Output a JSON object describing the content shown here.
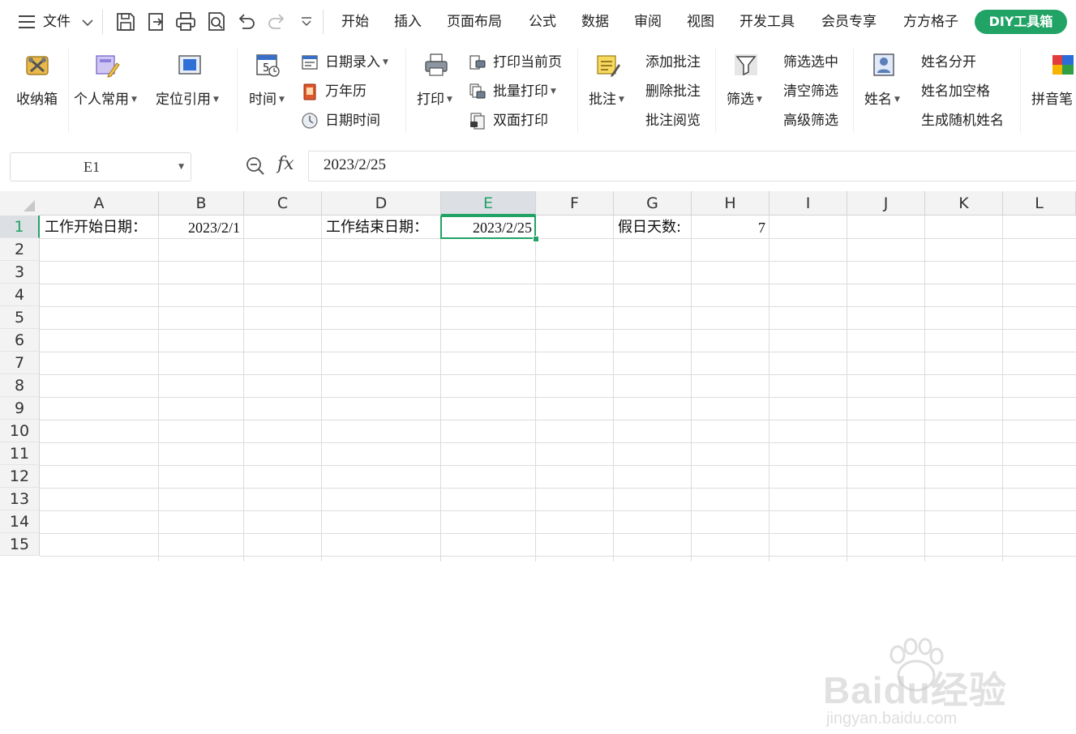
{
  "menubar": {
    "file_label": "文件",
    "tabs": [
      "开始",
      "插入",
      "页面布局",
      "公式",
      "数据",
      "审阅",
      "视图",
      "开发工具",
      "会员专享",
      "方方格子",
      "DIY工具箱"
    ],
    "active_tab": "DIY工具箱",
    "accent_color": "#21a366"
  },
  "ribbon": {
    "storage_box": "收纳箱",
    "personal_common": "个人常用",
    "locate_ref": "定位引用",
    "time": "时间",
    "date_entry": "日期录入",
    "perpetual_calendar": "万年历",
    "date_time": "日期时间",
    "print": "打印",
    "print_current_page": "打印当前页",
    "batch_print": "批量打印",
    "duplex_print": "双面打印",
    "comment": "批注",
    "add_comment": "添加批注",
    "delete_comment": "删除批注",
    "view_comments": "批注阅览",
    "filter": "筛选",
    "filter_selection": "筛选选中",
    "clear_filter": "清空筛选",
    "advanced_filter": "高级筛选",
    "name": "姓名",
    "split_name": "姓名分开",
    "name_add_space": "姓名加空格",
    "random_name": "生成随机姓名",
    "pinyin": "拼音笔"
  },
  "formula_bar": {
    "name_box": "E1",
    "fx_label": "fx",
    "formula": "2023/2/25"
  },
  "sheet": {
    "columns": [
      "A",
      "B",
      "C",
      "D",
      "E",
      "F",
      "G",
      "H",
      "I",
      "J",
      "K",
      "L"
    ],
    "rows": [
      "1",
      "2",
      "3",
      "4",
      "5",
      "6",
      "7",
      "8",
      "9",
      "10",
      "11",
      "12",
      "13",
      "14",
      "15"
    ],
    "active_column": "E",
    "active_row": "1",
    "cells": {
      "A1": "工作开始日期：",
      "B1": "2023/2/1",
      "D1": "工作结束日期：",
      "E1": "2023/2/25",
      "G1": "假日天数:",
      "H1": "7"
    }
  },
  "watermark": {
    "brand": "Baidu经验",
    "url": "jingyan.baidu.com"
  }
}
